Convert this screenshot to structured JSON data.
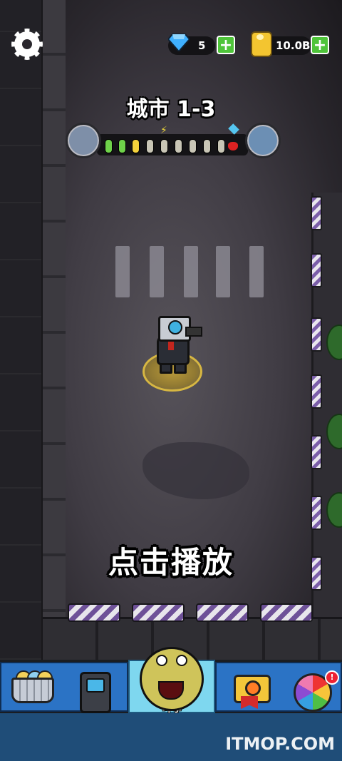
{
  "resources": {
    "gems": "5",
    "toilet_paper": "10.0B"
  },
  "level": {
    "title": "城市 1-3",
    "stage_pips": [
      "green",
      "green",
      "yellow",
      "plain",
      "plain",
      "plain",
      "plain",
      "plain",
      "plain"
    ]
  },
  "prompt": "点击播放",
  "nav": {
    "fight_label": "斗争",
    "spin_badge": "!"
  },
  "watermark": "ITMOP.COM",
  "colors": {
    "accent_blue": "#2b73c5",
    "active_tab": "#7ed7ef",
    "plus_green": "#4fc43a"
  }
}
